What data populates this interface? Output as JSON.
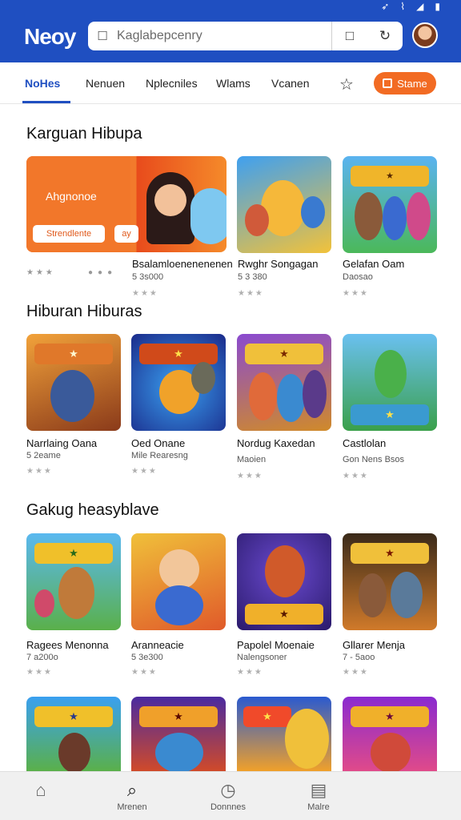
{
  "status_bar": {
    "icons": [
      "location-icon",
      "wifi-icon",
      "signal-icon",
      "battery-icon"
    ]
  },
  "header": {
    "logo": "Neoy",
    "search_placeholder": "Kaglabepcenry",
    "brand_color": "#1f4fc1"
  },
  "tabs": {
    "items": [
      {
        "label": "NoHes",
        "active": true
      },
      {
        "label": "Nenuen"
      },
      {
        "label": "Nplecniles"
      },
      {
        "label": "Wlams"
      },
      {
        "label": "Vcanen"
      }
    ],
    "share_label": "Stame",
    "accent_color": "#f26b23"
  },
  "sections": [
    {
      "title": "Karguan Hibupa",
      "banner": {
        "title": "Ahgnonoe",
        "button": "Strendlente",
        "tag": "ay"
      },
      "games": [
        {
          "name": "Bsalamloenenenenen",
          "sub": "5 3s000"
        },
        {
          "name": "Rwghr Songagan",
          "sub": "5 3 380"
        },
        {
          "name": "Gelafan Oam",
          "sub": "Daosao"
        }
      ]
    },
    {
      "title": "Hiburan Hiburas",
      "games": [
        {
          "name": "Narrlaing Oana",
          "sub": "5 2eame"
        },
        {
          "name": "Oed Onane",
          "sub": "Mile Rearesng"
        },
        {
          "name": "Nordug Kaxedan",
          "sub": "Maoien"
        },
        {
          "name": "Castlolan",
          "sub": "Gon Nens Bsos"
        }
      ]
    },
    {
      "title": "Gakug heasyblave",
      "games": [
        {
          "name": "Ragees Menonna",
          "sub": "7 a200o"
        },
        {
          "name": "Aranneacie",
          "sub": "5 3e300"
        },
        {
          "name": "Papolel Moenaie",
          "sub": "Nalengsoner"
        },
        {
          "name": "Gllarer Menja",
          "sub": "7 - 5aoo"
        }
      ]
    }
  ],
  "bottom_nav": [
    {
      "label": "",
      "icon": "home-icon"
    },
    {
      "label": "Mrenen",
      "icon": "search-icon",
      "active": true
    },
    {
      "label": "Donnnes",
      "icon": "clock-icon"
    },
    {
      "label": "Malre",
      "icon": "bag-icon"
    }
  ]
}
